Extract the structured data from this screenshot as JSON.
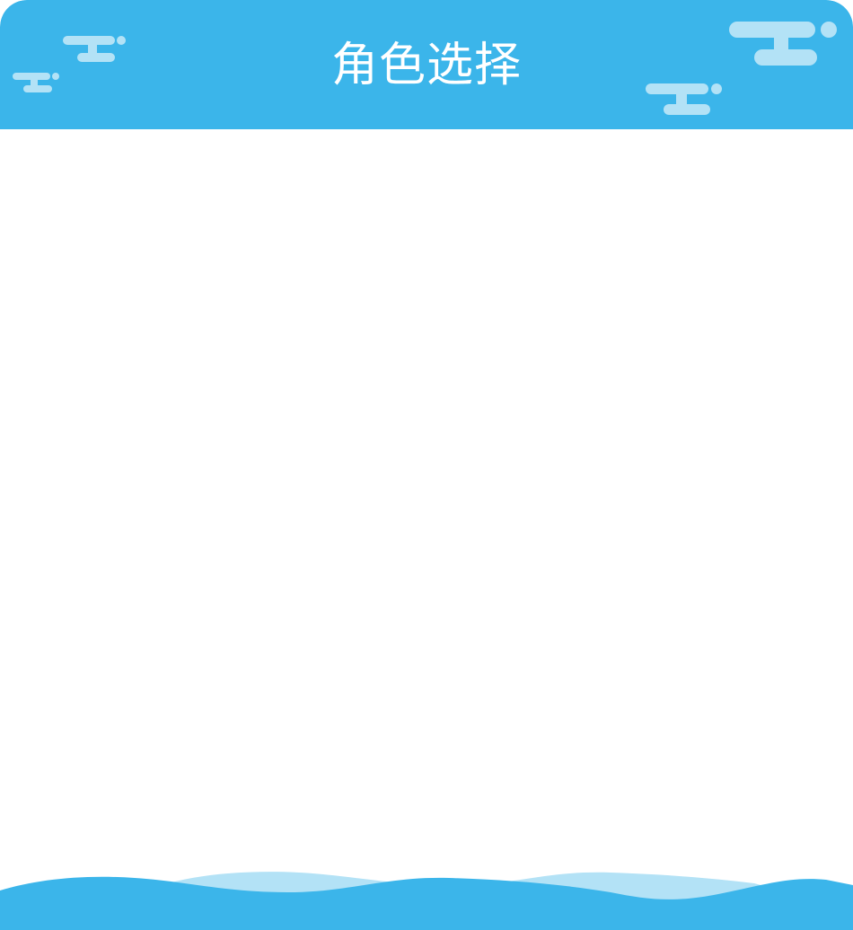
{
  "header": {
    "title": "角色选择"
  },
  "icons": {
    "clouds": "cloud-decoration-icon",
    "waves": "wave-decoration-icon"
  },
  "colors": {
    "header_bg": "#3bb5ea",
    "cloud": "#b3e2f6",
    "wave_front": "#3bb5ea",
    "wave_back": "#b3e2f6",
    "body_bg": "#ffffff",
    "title_text": "#ffffff"
  }
}
